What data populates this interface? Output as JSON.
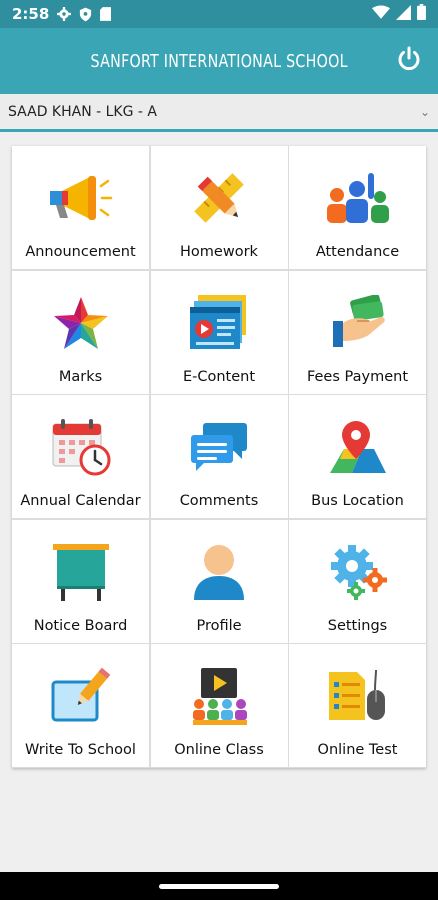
{
  "status": {
    "time": "2:58"
  },
  "app": {
    "title": "SANFORT INTERNATIONAL SCHOOL",
    "accent": "#3aa6b5"
  },
  "student": {
    "selected": "SAAD KHAN - LKG - A"
  },
  "tiles": [
    {
      "label": "Announcement",
      "icon": "megaphone-icon"
    },
    {
      "label": "Homework",
      "icon": "pencil-ruler-icon"
    },
    {
      "label": "Attendance",
      "icon": "students-raised-hand-icon"
    },
    {
      "label": "Marks",
      "icon": "star-icon"
    },
    {
      "label": "E-Content",
      "icon": "video-browser-icon"
    },
    {
      "label": "Fees Payment",
      "icon": "hand-money-icon"
    },
    {
      "label": "Annual Calendar",
      "icon": "calendar-clock-icon"
    },
    {
      "label": "Comments",
      "icon": "chat-bubbles-icon"
    },
    {
      "label": "Bus Location",
      "icon": "map-pin-icon"
    },
    {
      "label": "Notice Board",
      "icon": "notice-board-icon"
    },
    {
      "label": "Profile",
      "icon": "user-avatar-icon"
    },
    {
      "label": "Settings",
      "icon": "gears-icon"
    },
    {
      "label": "Write To School",
      "icon": "write-pencil-icon"
    },
    {
      "label": "Online Class",
      "icon": "online-class-icon"
    },
    {
      "label": "Online Test",
      "icon": "test-mouse-icon"
    }
  ]
}
